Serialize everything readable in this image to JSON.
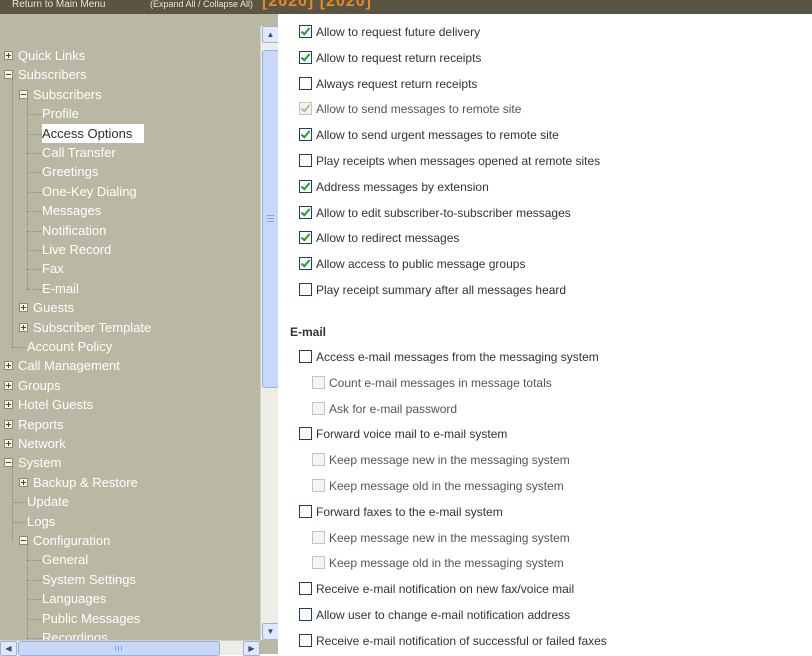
{
  "header": {
    "return_link": "Return to Main Menu",
    "expand_collapse": "(Expand All / Collapse All)",
    "brand_text": "[2020] [2020]"
  },
  "tree": [
    {
      "label": "Quick Links",
      "level": 0,
      "expander": "plus"
    },
    {
      "label": "Subscribers",
      "level": 0,
      "expander": "minus"
    },
    {
      "label": "Subscribers",
      "level": 1,
      "expander": "minus"
    },
    {
      "label": "Profile",
      "level": 2,
      "expander": "none"
    },
    {
      "label": "Access Options",
      "level": 2,
      "expander": "none",
      "selected": true
    },
    {
      "label": "Call Transfer",
      "level": 2,
      "expander": "none"
    },
    {
      "label": "Greetings",
      "level": 2,
      "expander": "none"
    },
    {
      "label": "One-Key Dialing",
      "level": 2,
      "expander": "none"
    },
    {
      "label": "Messages",
      "level": 2,
      "expander": "none"
    },
    {
      "label": "Notification",
      "level": 2,
      "expander": "none"
    },
    {
      "label": "Live Record",
      "level": 2,
      "expander": "none"
    },
    {
      "label": "Fax",
      "level": 2,
      "expander": "none"
    },
    {
      "label": "E-mail",
      "level": 2,
      "expander": "none"
    },
    {
      "label": "Guests",
      "level": 1,
      "expander": "plus"
    },
    {
      "label": "Subscriber Template",
      "level": 1,
      "expander": "plus"
    },
    {
      "label": "Account Policy",
      "level": 1,
      "expander": "none"
    },
    {
      "label": "Call Management",
      "level": 0,
      "expander": "plus"
    },
    {
      "label": "Groups",
      "level": 0,
      "expander": "plus"
    },
    {
      "label": "Hotel Guests",
      "level": 0,
      "expander": "plus"
    },
    {
      "label": "Reports",
      "level": 0,
      "expander": "plus"
    },
    {
      "label": "Network",
      "level": 0,
      "expander": "plus"
    },
    {
      "label": "System",
      "level": 0,
      "expander": "minus"
    },
    {
      "label": "Backup & Restore",
      "level": 1,
      "expander": "plus"
    },
    {
      "label": "Update",
      "level": 1,
      "expander": "none"
    },
    {
      "label": "Logs",
      "level": 1,
      "expander": "none"
    },
    {
      "label": "Configuration",
      "level": 1,
      "expander": "minus"
    },
    {
      "label": "General",
      "level": 2,
      "expander": "none"
    },
    {
      "label": "System Settings",
      "level": 2,
      "expander": "none"
    },
    {
      "label": "Languages",
      "level": 2,
      "expander": "none"
    },
    {
      "label": "Public Messages",
      "level": 2,
      "expander": "none"
    },
    {
      "label": "Recordings",
      "level": 2,
      "expander": "none"
    }
  ],
  "options": [
    {
      "label": "Allow to request future delivery",
      "checked": true,
      "disabled": false,
      "indent": 0
    },
    {
      "label": "Allow to request return receipts",
      "checked": true,
      "disabled": false,
      "indent": 0
    },
    {
      "label": "Always request return receipts",
      "checked": false,
      "disabled": false,
      "indent": 0
    },
    {
      "label": "Allow to send messages to remote site",
      "checked": true,
      "disabled": true,
      "indent": 0
    },
    {
      "label": "Allow to send urgent messages to remote site",
      "checked": true,
      "disabled": false,
      "indent": 0
    },
    {
      "label": "Play receipts when messages opened at remote sites",
      "checked": false,
      "disabled": false,
      "indent": 0
    },
    {
      "label": "Address messages by extension",
      "checked": true,
      "disabled": false,
      "indent": 0
    },
    {
      "label": "Allow to edit subscriber-to-subscriber messages",
      "checked": true,
      "disabled": false,
      "indent": 0
    },
    {
      "label": "Allow to redirect messages",
      "checked": true,
      "disabled": false,
      "indent": 0
    },
    {
      "label": "Allow access to public message groups",
      "checked": true,
      "disabled": false,
      "indent": 0
    },
    {
      "label": "Play receipt summary after all messages heard",
      "checked": false,
      "disabled": false,
      "indent": 0
    }
  ],
  "email_section": {
    "title": "E-mail",
    "options": [
      {
        "label": "Access e-mail messages from the messaging system",
        "checked": false,
        "disabled": false,
        "indent": 0
      },
      {
        "label": "Count e-mail messages in message totals",
        "checked": false,
        "disabled": true,
        "indent": 1
      },
      {
        "label": "Ask for e-mail password",
        "checked": false,
        "disabled": true,
        "indent": 1
      },
      {
        "label": "Forward voice mail to e-mail system",
        "checked": false,
        "disabled": false,
        "indent": 0
      },
      {
        "label": "Keep message new in the messaging system",
        "checked": false,
        "disabled": true,
        "indent": 1
      },
      {
        "label": "Keep message old in the messaging system",
        "checked": false,
        "disabled": true,
        "indent": 1
      },
      {
        "label": "Forward faxes to the e-mail system",
        "checked": false,
        "disabled": false,
        "indent": 0
      },
      {
        "label": "Keep message new in the messaging system",
        "checked": false,
        "disabled": true,
        "indent": 1
      },
      {
        "label": "Keep message old in the messaging system",
        "checked": false,
        "disabled": true,
        "indent": 1
      },
      {
        "label": "Receive e-mail notification on new fax/voice mail",
        "checked": false,
        "disabled": false,
        "indent": 0
      },
      {
        "label": "Allow user to change e-mail notification address",
        "checked": false,
        "disabled": false,
        "indent": 0
      },
      {
        "label": "Receive e-mail notification of successful or failed faxes",
        "checked": false,
        "disabled": false,
        "indent": 0
      }
    ]
  },
  "scrollbar": {
    "up_icon": "scroll-up-arrow-icon",
    "down_icon": "scroll-down-arrow-icon",
    "left_icon": "scroll-left-arrow-icon",
    "right_icon": "scroll-right-arrow-icon"
  },
  "colors": {
    "tree_bg": "#b9b8a3",
    "header_bg": "#5a5444",
    "brand": "#e98a1c",
    "check": "#21a121"
  }
}
